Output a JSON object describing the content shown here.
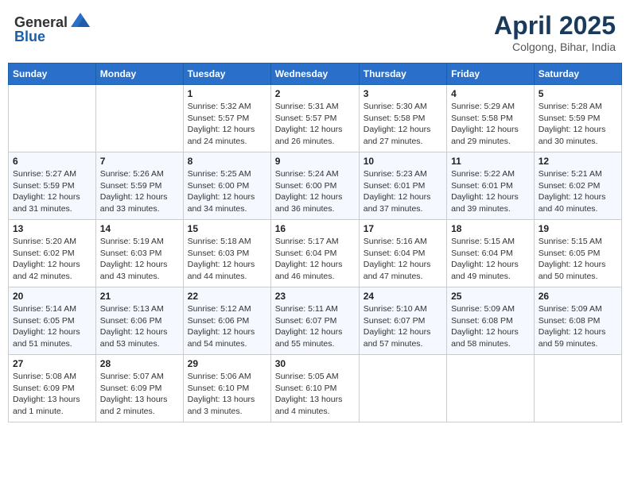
{
  "header": {
    "logo_general": "General",
    "logo_blue": "Blue",
    "title": "April 2025",
    "location": "Colgong, Bihar, India"
  },
  "calendar": {
    "days_of_week": [
      "Sunday",
      "Monday",
      "Tuesday",
      "Wednesday",
      "Thursday",
      "Friday",
      "Saturday"
    ],
    "weeks": [
      [
        {
          "day": "",
          "info": ""
        },
        {
          "day": "",
          "info": ""
        },
        {
          "day": "1",
          "info": "Sunrise: 5:32 AM\nSunset: 5:57 PM\nDaylight: 12 hours\nand 24 minutes."
        },
        {
          "day": "2",
          "info": "Sunrise: 5:31 AM\nSunset: 5:57 PM\nDaylight: 12 hours\nand 26 minutes."
        },
        {
          "day": "3",
          "info": "Sunrise: 5:30 AM\nSunset: 5:58 PM\nDaylight: 12 hours\nand 27 minutes."
        },
        {
          "day": "4",
          "info": "Sunrise: 5:29 AM\nSunset: 5:58 PM\nDaylight: 12 hours\nand 29 minutes."
        },
        {
          "day": "5",
          "info": "Sunrise: 5:28 AM\nSunset: 5:59 PM\nDaylight: 12 hours\nand 30 minutes."
        }
      ],
      [
        {
          "day": "6",
          "info": "Sunrise: 5:27 AM\nSunset: 5:59 PM\nDaylight: 12 hours\nand 31 minutes."
        },
        {
          "day": "7",
          "info": "Sunrise: 5:26 AM\nSunset: 5:59 PM\nDaylight: 12 hours\nand 33 minutes."
        },
        {
          "day": "8",
          "info": "Sunrise: 5:25 AM\nSunset: 6:00 PM\nDaylight: 12 hours\nand 34 minutes."
        },
        {
          "day": "9",
          "info": "Sunrise: 5:24 AM\nSunset: 6:00 PM\nDaylight: 12 hours\nand 36 minutes."
        },
        {
          "day": "10",
          "info": "Sunrise: 5:23 AM\nSunset: 6:01 PM\nDaylight: 12 hours\nand 37 minutes."
        },
        {
          "day": "11",
          "info": "Sunrise: 5:22 AM\nSunset: 6:01 PM\nDaylight: 12 hours\nand 39 minutes."
        },
        {
          "day": "12",
          "info": "Sunrise: 5:21 AM\nSunset: 6:02 PM\nDaylight: 12 hours\nand 40 minutes."
        }
      ],
      [
        {
          "day": "13",
          "info": "Sunrise: 5:20 AM\nSunset: 6:02 PM\nDaylight: 12 hours\nand 42 minutes."
        },
        {
          "day": "14",
          "info": "Sunrise: 5:19 AM\nSunset: 6:03 PM\nDaylight: 12 hours\nand 43 minutes."
        },
        {
          "day": "15",
          "info": "Sunrise: 5:18 AM\nSunset: 6:03 PM\nDaylight: 12 hours\nand 44 minutes."
        },
        {
          "day": "16",
          "info": "Sunrise: 5:17 AM\nSunset: 6:04 PM\nDaylight: 12 hours\nand 46 minutes."
        },
        {
          "day": "17",
          "info": "Sunrise: 5:16 AM\nSunset: 6:04 PM\nDaylight: 12 hours\nand 47 minutes."
        },
        {
          "day": "18",
          "info": "Sunrise: 5:15 AM\nSunset: 6:04 PM\nDaylight: 12 hours\nand 49 minutes."
        },
        {
          "day": "19",
          "info": "Sunrise: 5:15 AM\nSunset: 6:05 PM\nDaylight: 12 hours\nand 50 minutes."
        }
      ],
      [
        {
          "day": "20",
          "info": "Sunrise: 5:14 AM\nSunset: 6:05 PM\nDaylight: 12 hours\nand 51 minutes."
        },
        {
          "day": "21",
          "info": "Sunrise: 5:13 AM\nSunset: 6:06 PM\nDaylight: 12 hours\nand 53 minutes."
        },
        {
          "day": "22",
          "info": "Sunrise: 5:12 AM\nSunset: 6:06 PM\nDaylight: 12 hours\nand 54 minutes."
        },
        {
          "day": "23",
          "info": "Sunrise: 5:11 AM\nSunset: 6:07 PM\nDaylight: 12 hours\nand 55 minutes."
        },
        {
          "day": "24",
          "info": "Sunrise: 5:10 AM\nSunset: 6:07 PM\nDaylight: 12 hours\nand 57 minutes."
        },
        {
          "day": "25",
          "info": "Sunrise: 5:09 AM\nSunset: 6:08 PM\nDaylight: 12 hours\nand 58 minutes."
        },
        {
          "day": "26",
          "info": "Sunrise: 5:09 AM\nSunset: 6:08 PM\nDaylight: 12 hours\nand 59 minutes."
        }
      ],
      [
        {
          "day": "27",
          "info": "Sunrise: 5:08 AM\nSunset: 6:09 PM\nDaylight: 13 hours\nand 1 minute."
        },
        {
          "day": "28",
          "info": "Sunrise: 5:07 AM\nSunset: 6:09 PM\nDaylight: 13 hours\nand 2 minutes."
        },
        {
          "day": "29",
          "info": "Sunrise: 5:06 AM\nSunset: 6:10 PM\nDaylight: 13 hours\nand 3 minutes."
        },
        {
          "day": "30",
          "info": "Sunrise: 5:05 AM\nSunset: 6:10 PM\nDaylight: 13 hours\nand 4 minutes."
        },
        {
          "day": "",
          "info": ""
        },
        {
          "day": "",
          "info": ""
        },
        {
          "day": "",
          "info": ""
        }
      ]
    ]
  }
}
